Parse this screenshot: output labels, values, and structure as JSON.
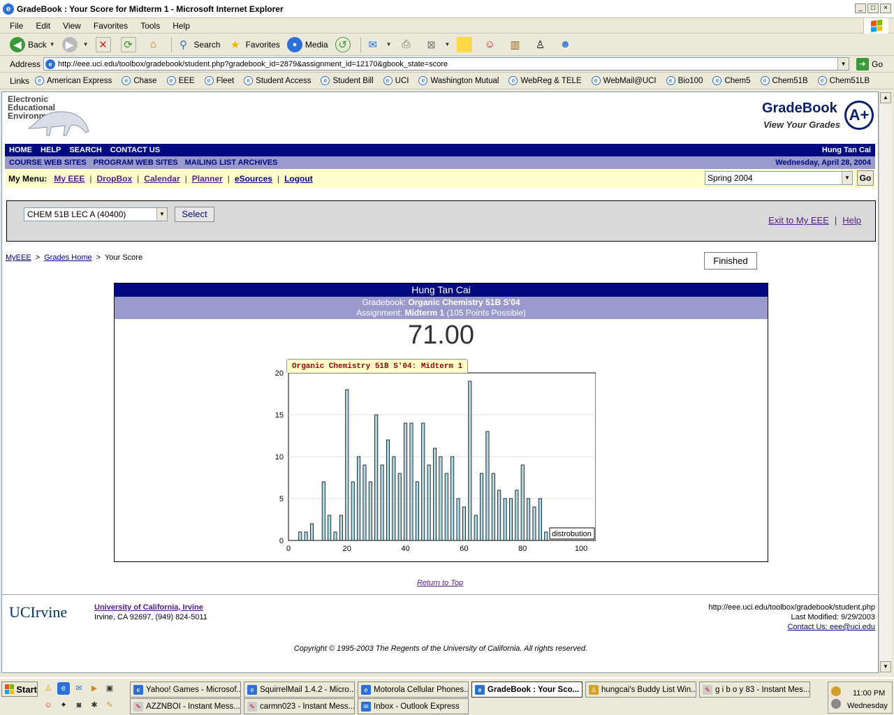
{
  "window": {
    "title": "GradeBook : Your Score for Midterm 1 - Microsoft Internet Explorer",
    "controls": [
      "_",
      "□",
      "×"
    ]
  },
  "menu": [
    "File",
    "Edit",
    "View",
    "Favorites",
    "Tools",
    "Help"
  ],
  "toolbar": {
    "back": "Back",
    "search": "Search",
    "favorites": "Favorites",
    "media": "Media"
  },
  "address": {
    "label": "Address",
    "url": "http://eee.uci.edu/toolbox/gradebook/student.php?gradebook_id=2879&assignment_id=12170&gbook_state=score",
    "go": "Go"
  },
  "links": {
    "label": "Links",
    "items": [
      "American Express",
      "Chase",
      "EEE",
      "Fleet",
      "Student Access",
      "Student Bill",
      "UCI",
      "Washington Mutual",
      "WebReg & TELE",
      "WebMail@UCI",
      "Bio100",
      "Chem5",
      "Chem51B",
      "Chem51LB"
    ]
  },
  "page": {
    "eee_logo": [
      "Electronic",
      "Educational",
      "Environment"
    ],
    "gradebook_title": "GradeBook",
    "gradebook_sub": "View Your Grades",
    "gradebook_mark": "A+",
    "nav1": [
      "HOME",
      "HELP",
      "SEARCH",
      "CONTACT US"
    ],
    "user": "Hung Tan Cai",
    "nav2": [
      "COURSE WEB SITES",
      "PROGRAM WEB SITES",
      "MAILING LIST ARCHIVES"
    ],
    "date": "Wednesday, April 28, 2004",
    "my_menu_label": "My Menu:",
    "my_menu": [
      "My EEE",
      "DropBox",
      "Calendar",
      "Planner",
      "eSources",
      "Logout"
    ],
    "term": "Spring 2004",
    "term_go": "Go",
    "course": "CHEM 51B LEC A (40400)",
    "select": "Select",
    "exit": "Exit to My EEE",
    "help": "Help",
    "crumbs": [
      "MyEEE",
      "Grades Home",
      "Your Score"
    ],
    "finished": "Finished",
    "score": {
      "student": "Hung Tan Cai",
      "gradebook_label": "Gradebook:",
      "gradebook_name": "Organic Chemistry 51B S'04",
      "assignment_label": "Assignment:",
      "assignment_name": "Midterm 1",
      "points": "(105 Points Possible)",
      "value": "71.00"
    },
    "return_top": "Return to Top",
    "footer": {
      "uci_logo": "UCIrvine",
      "uci_name": "University of California, Irvine",
      "uci_addr": "Irvine, CA 92697, (949) 824-5011",
      "url": "http://eee.uci.edu/toolbox/gradebook/student.php",
      "modified": "Last Modified: 9/29/2003",
      "contact": "Contact Us: eee@uci.edu",
      "copyright": "Copyright © 1995-2003 The Regents of the University of California. All rights reserved."
    }
  },
  "chart_data": {
    "type": "bar",
    "title": "Organic Chemistry 51B S'04: Midterm 1",
    "legend": "distrobution",
    "legend_position": "bottom-right",
    "xlim": [
      0,
      105
    ],
    "ylim": [
      0,
      20
    ],
    "xticks": [
      0,
      20,
      40,
      60,
      80,
      100
    ],
    "yticks": [
      0,
      5,
      10,
      15,
      20
    ],
    "grid": true,
    "bar_color": "#add8e6",
    "x": [
      4,
      6,
      8,
      10,
      12,
      14,
      16,
      18,
      20,
      22,
      24,
      26,
      28,
      30,
      32,
      34,
      36,
      38,
      40,
      42,
      44,
      46,
      48,
      50,
      52,
      54,
      56,
      58,
      60,
      62,
      64,
      66,
      68,
      70,
      72,
      74,
      76,
      78,
      80,
      82,
      84,
      86,
      88,
      90
    ],
    "values": [
      1,
      1,
      2,
      0,
      7,
      3,
      1,
      3,
      18,
      7,
      10,
      9,
      7,
      15,
      9,
      12,
      10,
      8,
      14,
      14,
      7,
      14,
      9,
      11,
      10,
      8,
      10,
      5,
      4,
      19,
      3,
      8,
      13,
      8,
      6,
      5,
      5,
      6,
      9,
      5,
      4,
      5,
      1,
      0
    ]
  },
  "taskbar": {
    "start": "Start",
    "tasks": [
      "Yahoo! Games - Microsof...",
      "SquirrelMail 1.4.2 - Micro...",
      "Motorola Cellular Phones...",
      "GradeBook : Your Sco...",
      "hungcai's Buddy List Win...",
      "g i b o y 83 - Instant Mes...",
      "AZZNBOI - Instant Mess...",
      "carmn023 - Instant Mess...",
      "Inbox - Outlook Express"
    ],
    "time": "11:00 PM",
    "day": "Wednesday"
  }
}
